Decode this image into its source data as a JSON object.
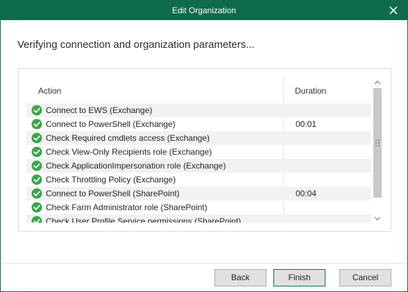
{
  "window": {
    "title": "Edit Organization"
  },
  "heading": "Verifying connection and organization parameters...",
  "grid": {
    "columns": {
      "action": "Action",
      "duration": "Duration"
    },
    "rows": [
      {
        "action": "Connect to EWS (Exchange)",
        "duration": "",
        "status": "success"
      },
      {
        "action": "Connect to PowerShell (Exchange)",
        "duration": "00:01",
        "status": "success"
      },
      {
        "action": "Check Required cmdlets access (Exchange)",
        "duration": "",
        "status": "success"
      },
      {
        "action": "Check View-Only Recipients role (Exchange)",
        "duration": "",
        "status": "success"
      },
      {
        "action": "Check ApplicationImpersonation role (Exchange)",
        "duration": "",
        "status": "success"
      },
      {
        "action": "Check Throttling Policy (Exchange)",
        "duration": "",
        "status": "success"
      },
      {
        "action": "Connect to PowerShell (SharePoint)",
        "duration": "00:04",
        "status": "success"
      },
      {
        "action": "Check Farm Administrator role (SharePoint)",
        "duration": "",
        "status": "success"
      },
      {
        "action": "Check User Profile Service permissions (SharePoint)",
        "duration": "",
        "status": "success"
      }
    ]
  },
  "buttons": {
    "back": "Back",
    "finish": "Finish",
    "cancel": "Cancel"
  },
  "colors": {
    "accent": "#0e6b49",
    "success": "#3aa64a"
  }
}
